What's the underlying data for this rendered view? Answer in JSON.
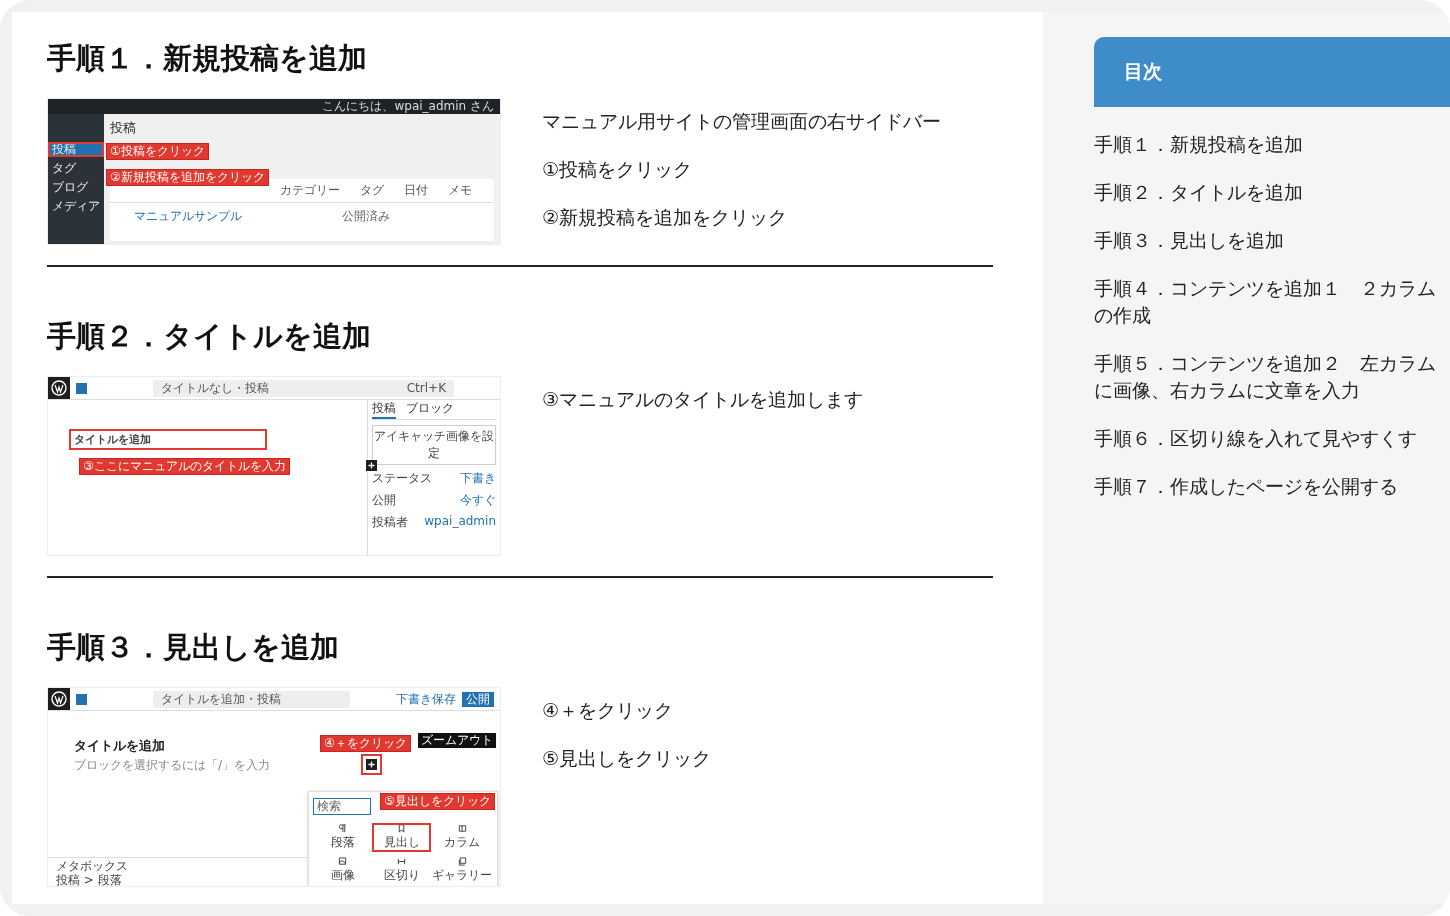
{
  "steps": [
    {
      "title": "手順１．新規投稿を追加",
      "shot": {
        "kind": "admin",
        "greeting": "こんにちは、wpai_admin さん",
        "menu": [
          {
            "label": "投稿",
            "selected": true
          },
          {
            "label": "タグ",
            "selected": false
          },
          {
            "label": "ブログ",
            "selected": false
          },
          {
            "label": "メディア",
            "selected": false
          }
        ],
        "page_title": "投稿",
        "columns": [
          "カテゴリー",
          "タグ",
          "日付",
          "メモ"
        ],
        "row": {
          "title": "マニュアルサンプル",
          "status": "公開済み"
        },
        "callouts": [
          "①投稿をクリック",
          "②新規投稿を追加をクリック"
        ]
      },
      "notes": [
        "マニュアル用サイトの管理画面の右サイドバー",
        "①投稿をクリック",
        "②新規投稿を追加をクリック"
      ]
    },
    {
      "title": "手順２．タイトルを追加",
      "shot": {
        "kind": "editor",
        "doc_title": "タイトルなし・投稿",
        "shortcut": "Ctrl+K",
        "title_field": "タイトルを追加",
        "callouts": [
          "③ここにマニュアルのタイトルを入力"
        ],
        "tabs": [
          {
            "label": "投稿",
            "selected": true
          },
          {
            "label": "ブロック",
            "selected": false
          }
        ],
        "featured": "アイキャッチ画像を設定",
        "fields": [
          {
            "label": "ステータス",
            "value": "下書き"
          },
          {
            "label": "公開",
            "value": "今すぐ"
          },
          {
            "label": "投稿者",
            "value": "wpai_admin"
          }
        ]
      },
      "notes": [
        "③マニュアルのタイトルを追加します"
      ]
    },
    {
      "title": "手順３．見出しを追加",
      "shot": {
        "kind": "inserter",
        "doc_title": "タイトルを追加・投稿",
        "save": "下書き保存",
        "publish": "公開",
        "title_text": "タイトルを追加",
        "placeholder": "ブロックを選択するには「/」を入力",
        "tooltip": "ズームアウト",
        "callouts": [
          "④＋をクリック",
          "⑤見出しをクリック"
        ],
        "search": "検索",
        "blocks": [
          {
            "label": "段落",
            "selected": false
          },
          {
            "label": "見出し",
            "selected": true
          },
          {
            "label": "カラム",
            "selected": false
          },
          {
            "label": "画像",
            "selected": false
          },
          {
            "label": "区切り",
            "selected": false
          },
          {
            "label": "ギャラリー",
            "selected": false
          }
        ],
        "footer": "メタボックス",
        "breadcrumb": "投稿 > 段落"
      },
      "notes": [
        "④＋をクリック",
        "⑤見出しをクリック"
      ]
    }
  ],
  "toc": {
    "title": "目次",
    "items": [
      "手順１．新規投稿を追加",
      "手順２．タイトルを追加",
      "手順３．見出しを追加",
      "手順４．コンテンツを追加１　２カラムの作成",
      "手順５．コンテンツを追加２　左カラムに画像、右カラムに文章を入力",
      "手順６．区切り線を入れて見やすくす",
      "手順７．作成したページを公開する"
    ]
  }
}
